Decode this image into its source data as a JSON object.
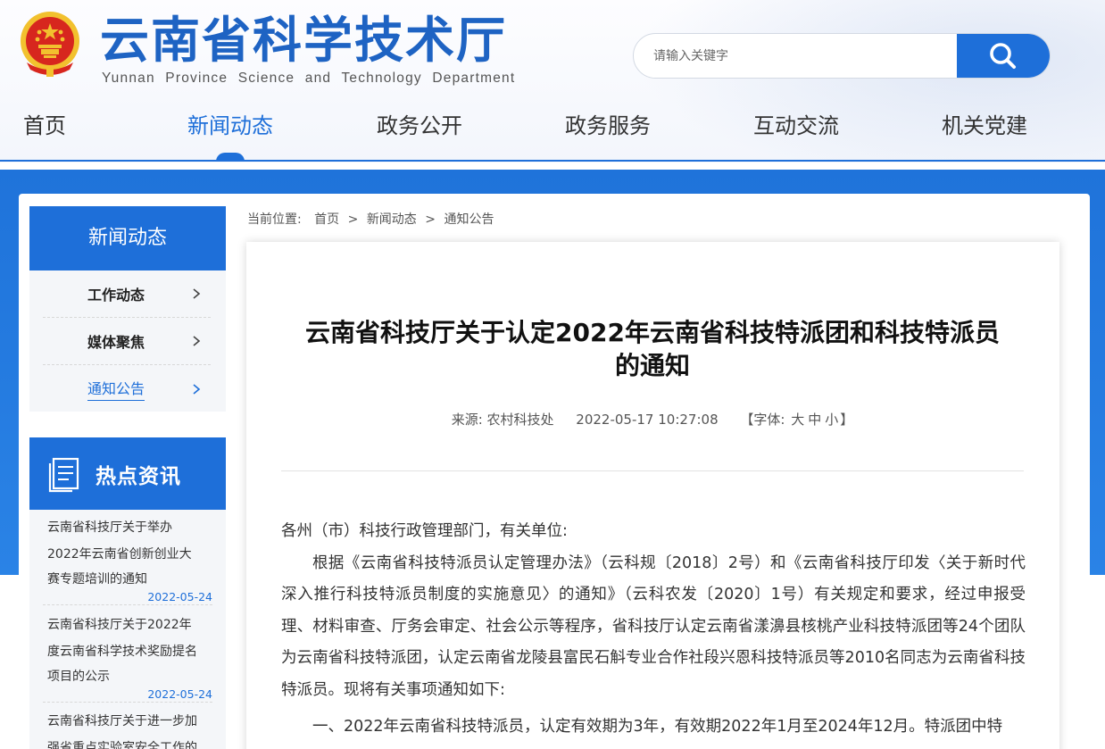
{
  "header": {
    "title": "云南省科学技术厅",
    "subtitle": "Yunnan Province Science and Technology Department",
    "search_placeholder": "请输入关键字"
  },
  "nav": {
    "items": [
      {
        "label": "首页"
      },
      {
        "label": "新闻动态"
      },
      {
        "label": "政务公开"
      },
      {
        "label": "政务服务"
      },
      {
        "label": "互动交流"
      },
      {
        "label": "机关党建"
      }
    ],
    "active_index": 1
  },
  "sidebar": {
    "title": "新闻动态",
    "items": [
      {
        "label": "工作动态"
      },
      {
        "label": "媒体聚焦"
      },
      {
        "label": "通知公告"
      }
    ],
    "active_index": 2
  },
  "hot_news": {
    "title": "热点资讯",
    "items": [
      {
        "title_lines": [
          "云南省科技厅关于举办",
          "2022年云南省创新创业大",
          "赛专题培训的通知"
        ],
        "date": "2022-05-24"
      },
      {
        "title_lines": [
          "云南省科技厅关于2022年",
          "度云南省科学技术奖励提名",
          "项目的公示"
        ],
        "date": "2022-05-24"
      },
      {
        "title_lines": [
          "云南省科技厅关于进一步加",
          "强省重点实验室安全工作的"
        ],
        "date": ""
      }
    ]
  },
  "breadcrumb": {
    "prefix": "当前位置:",
    "items": [
      "首页",
      "新闻动态",
      "通知公告"
    ],
    "separator": ">"
  },
  "article": {
    "title_line1": "云南省科技厅关于认定2022年云南省科技特派团和科技特派员",
    "title_line2": "的通知",
    "source": "来源: 农村科技处",
    "datetime": "2022-05-17 10:27:08",
    "font_size_label": "【字体:",
    "font_sizes": [
      "大",
      "中",
      "小"
    ],
    "font_size_close": "】",
    "salutation": "各州（市）科技行政管理部门，有关单位:",
    "paragraph1": "根据《云南省科技特派员认定管理办法》（云科规〔2018〕2号）和《云南省科技厅印发〈关于新时代深入推行科技特派员制度的实施意见〉的通知》（云科农发〔2020〕1号）有关规定和要求，经过申报受理、材料审查、厅务会审定、社会公示等程序，省科技厅认定云南省漾濞县核桃产业科技特派团等24个团队为云南省科技特派团，认定云南省龙陵县富民石斛专业合作社段兴恩科技特派员等2010名同志为云南省科技特派员。现将有关事项通知如下:",
    "paragraph2": "一、2022年云南省科技特派员，认定有效期为3年，有效期2022年1月至2024年12月。特派团中特"
  },
  "colors": {
    "brand_blue": "#1e6fd9",
    "title_blue": "#1e63c3",
    "emblem_red": "#d7261e",
    "emblem_gold": "#f2c12e"
  }
}
